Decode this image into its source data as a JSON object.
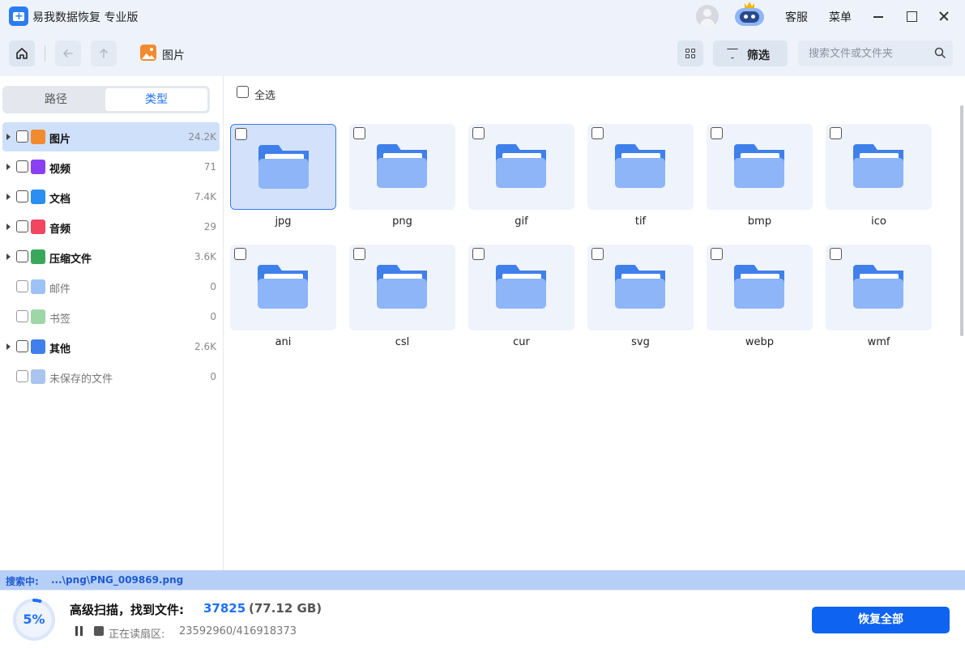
{
  "app": {
    "title": "易我数据恢复 专业版",
    "support_label": "客服",
    "menu_label": "菜单"
  },
  "toolbar": {
    "breadcrumb_label": "图片",
    "filter_label": "筛选",
    "search_placeholder": "搜索文件或文件夹"
  },
  "sidebar": {
    "tabs": [
      {
        "label": "路径",
        "active": false
      },
      {
        "label": "类型",
        "active": true
      }
    ],
    "categories": [
      {
        "label": "图片",
        "count": "24.2K",
        "icon": "image-icon",
        "expandable": true,
        "selected": true,
        "color": "#f28a2e"
      },
      {
        "label": "视频",
        "count": "71",
        "icon": "video-icon",
        "expandable": true,
        "selected": false,
        "color": "#8a3ff2"
      },
      {
        "label": "文档",
        "count": "7.4K",
        "icon": "document-icon",
        "expandable": true,
        "selected": false,
        "color": "#2b8ef2"
      },
      {
        "label": "音频",
        "count": "29",
        "icon": "audio-icon",
        "expandable": true,
        "selected": false,
        "color": "#f2455f"
      },
      {
        "label": "压缩文件",
        "count": "3.6K",
        "icon": "archive-icon",
        "expandable": true,
        "selected": false,
        "color": "#3aa85a"
      },
      {
        "label": "邮件",
        "count": "0",
        "icon": "mail-icon",
        "expandable": false,
        "selected": false,
        "color": "#9fc2f5"
      },
      {
        "label": "书签",
        "count": "0",
        "icon": "bookmark-icon",
        "expandable": false,
        "selected": false,
        "color": "#9fd6a8"
      },
      {
        "label": "其他",
        "count": "2.6K",
        "icon": "other-folder-icon",
        "expandable": true,
        "selected": false,
        "color": "#3f80ea"
      },
      {
        "label": "未保存的文件",
        "count": "0",
        "icon": "unsaved-file-icon",
        "expandable": false,
        "selected": false,
        "color": "#a9c4ee"
      }
    ]
  },
  "main": {
    "select_all_label": "全选",
    "folders": [
      {
        "label": "jpg",
        "selected": true
      },
      {
        "label": "png",
        "selected": false
      },
      {
        "label": "gif",
        "selected": false
      },
      {
        "label": "tif",
        "selected": false
      },
      {
        "label": "bmp",
        "selected": false
      },
      {
        "label": "ico",
        "selected": false
      },
      {
        "label": "ani",
        "selected": false
      },
      {
        "label": "csl",
        "selected": false
      },
      {
        "label": "cur",
        "selected": false
      },
      {
        "label": "svg",
        "selected": false
      },
      {
        "label": "webp",
        "selected": false
      },
      {
        "label": "wmf",
        "selected": false
      }
    ]
  },
  "status": {
    "prefix": "搜索中:",
    "current_path": "...\\png\\PNG_009869.png"
  },
  "footer": {
    "progress_text": "5%",
    "progress_fraction": 0.05,
    "scan_title": "高级扫描，找到文件:",
    "found_count": "37825",
    "found_size": "(77.12 GB)",
    "sector_label": "正在读扇区:",
    "sector_value": "23592960/416918373",
    "recover_all_label": "恢复全部",
    "accent_color": "#1f6ff5"
  }
}
